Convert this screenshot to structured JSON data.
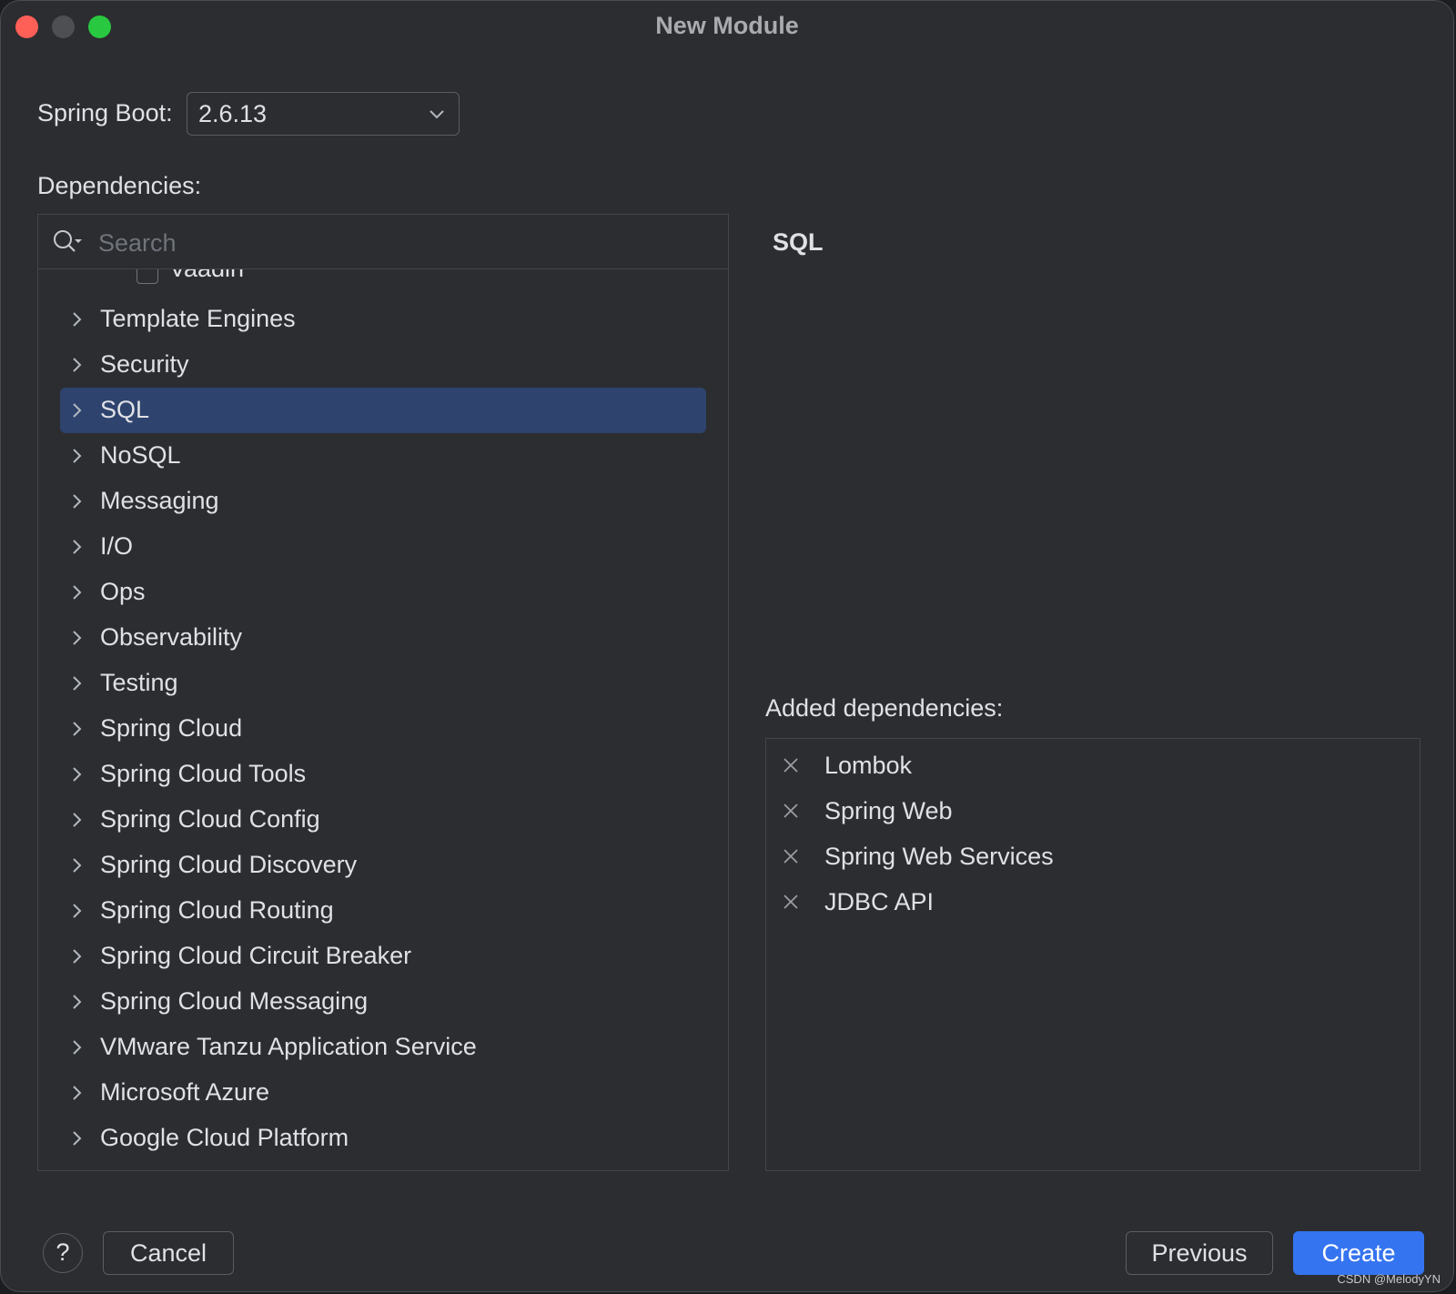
{
  "window": {
    "title": "New Module"
  },
  "spring_boot": {
    "label": "Spring Boot:",
    "value": "2.6.13"
  },
  "dependencies": {
    "label": "Dependencies:",
    "search_placeholder": "Search",
    "partial_item": "Vaadin",
    "categories": [
      "Template Engines",
      "Security",
      "SQL",
      "NoSQL",
      "Messaging",
      "I/O",
      "Ops",
      "Observability",
      "Testing",
      "Spring Cloud",
      "Spring Cloud Tools",
      "Spring Cloud Config",
      "Spring Cloud Discovery",
      "Spring Cloud Routing",
      "Spring Cloud Circuit Breaker",
      "Spring Cloud Messaging",
      "VMware Tanzu Application Service",
      "Microsoft Azure",
      "Google Cloud Platform"
    ],
    "selected": "SQL"
  },
  "detail": {
    "title": "SQL"
  },
  "added": {
    "label": "Added dependencies:",
    "items": [
      "Lombok",
      "Spring Web",
      "Spring Web Services",
      "JDBC API"
    ]
  },
  "footer": {
    "help": "?",
    "cancel": "Cancel",
    "previous": "Previous",
    "create": "Create"
  },
  "watermark": "CSDN @MelodyYN",
  "colors": {
    "background": "#2b2d30",
    "selection": "#2e436e",
    "accent": "#3574f0",
    "close": "#fe5f57",
    "minimize": "#4d4f53",
    "maximize": "#28c840"
  }
}
